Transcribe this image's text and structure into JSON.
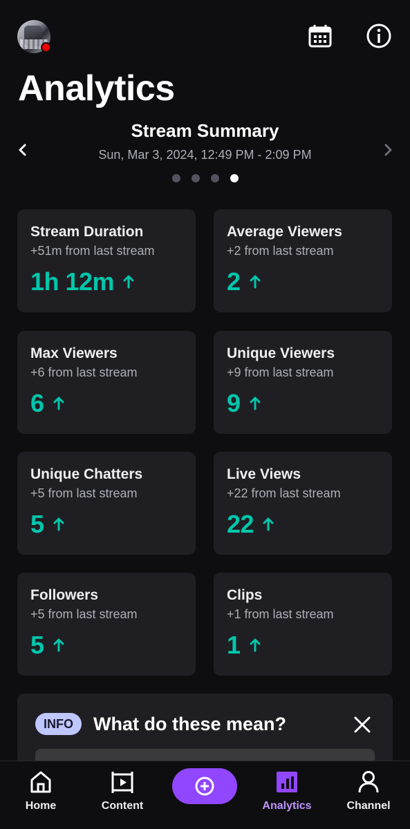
{
  "header": {
    "page_title": "Analytics",
    "live_indicator_color": "#eb0400",
    "icons": [
      "calendar-icon",
      "info-icon"
    ]
  },
  "summary": {
    "title": "Stream Summary",
    "date_range": "Sun, Mar 3, 2024, 12:49 PM - 2:09 PM",
    "page_count": 4,
    "active_page": 4
  },
  "stats": [
    {
      "title": "Stream Duration",
      "sub": "+51m from last stream",
      "value": "1h 12m"
    },
    {
      "title": "Average Viewers",
      "sub": "+2 from last stream",
      "value": "2"
    },
    {
      "title": "Max Viewers",
      "sub": "+6 from last stream",
      "value": "6"
    },
    {
      "title": "Unique Viewers",
      "sub": "+9 from last stream",
      "value": "9"
    },
    {
      "title": "Unique Chatters",
      "sub": "+5 from last stream",
      "value": "5"
    },
    {
      "title": "Live Views",
      "sub": "+22 from last stream",
      "value": "22"
    },
    {
      "title": "Followers",
      "sub": "+5 from last stream",
      "value": "5"
    },
    {
      "title": "Clips",
      "sub": "+1 from last stream",
      "value": "1"
    }
  ],
  "info_card": {
    "badge": "INFO",
    "title": "What do these mean?"
  },
  "bottom_nav": {
    "items": [
      {
        "label": "Home",
        "icon": "home-icon"
      },
      {
        "label": "Content",
        "icon": "film-icon"
      },
      {
        "label": "Analytics",
        "icon": "analytics-icon",
        "active": true
      },
      {
        "label": "Channel",
        "icon": "person-icon"
      }
    ],
    "go_live_icon": "plus-circle-icon"
  },
  "colors": {
    "accent_purple": "#9147ff",
    "active_label": "#bf94ff",
    "stat_value": "#00c7ac",
    "card_bg": "#1f1f23",
    "background": "#0e0e10"
  }
}
